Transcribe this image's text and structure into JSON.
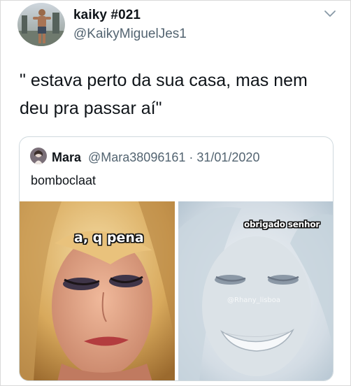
{
  "author": {
    "display_name": "kaiky #021",
    "handle": "@KaikyMiguelJes1",
    "avatar_icon": "profile-photo"
  },
  "tweet": {
    "text": "\" estava perto da sua casa, mas nem deu pra passar aí\""
  },
  "quoted_tweet": {
    "name": "Mara",
    "meta": "@Mara38096161 · 31/01/2020",
    "text": "bomboclaat",
    "images": {
      "left_caption": "a, q pena",
      "right_caption": "obrigado senhor",
      "right_watermark": "@Rhany_lisboa"
    }
  },
  "icons": {
    "menu": "chevron-down-icon"
  },
  "colors": {
    "text_primary": "#0f1419",
    "text_secondary": "#536471",
    "card_border": "#cfd9de"
  }
}
